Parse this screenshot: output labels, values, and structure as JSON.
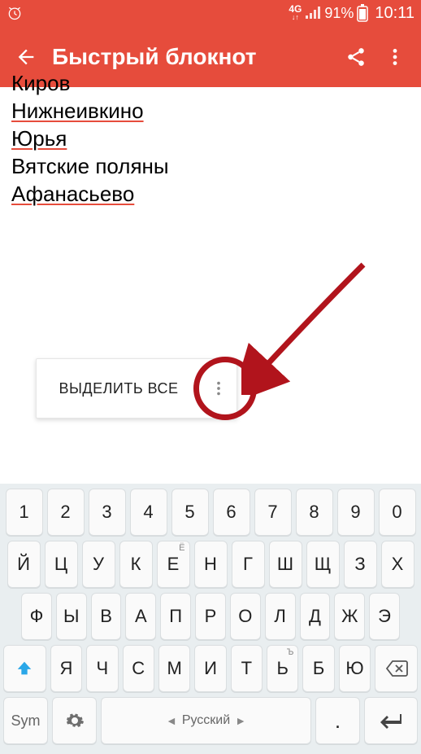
{
  "status": {
    "network": "4G",
    "battery_pct": "91%",
    "time": "10:11"
  },
  "appbar": {
    "title": "Быстрый блокнот"
  },
  "note": {
    "lines": [
      {
        "text": "Киров",
        "underline": false,
        "clipped": true
      },
      {
        "text": "Нижнеивкино",
        "underline": true
      },
      {
        "text": "Юрья",
        "underline": true
      },
      {
        "text": "Вятские поляны",
        "underline": false
      },
      {
        "text": "Афанасьево",
        "underline": true
      }
    ]
  },
  "popup": {
    "select_all": "ВЫДЕЛИТЬ ВСЕ"
  },
  "keyboard": {
    "row_num": [
      "1",
      "2",
      "3",
      "4",
      "5",
      "6",
      "7",
      "8",
      "9",
      "0"
    ],
    "row1": [
      "Й",
      "Ц",
      "У",
      "К",
      "Е",
      "Н",
      "Г",
      "Ш",
      "Щ",
      "З",
      "Х"
    ],
    "row1_sup": {
      "4": "Ё"
    },
    "row2": [
      "Ф",
      "Ы",
      "В",
      "А",
      "П",
      "Р",
      "О",
      "Л",
      "Д",
      "Ж",
      "Э"
    ],
    "row3": [
      "Я",
      "Ч",
      "С",
      "М",
      "И",
      "Т",
      "Ь",
      "Б",
      "Ю"
    ],
    "row3_sup": {
      "6": "Ъ"
    },
    "sym": "Sym",
    "space_label": "Русский",
    "dot": "."
  }
}
